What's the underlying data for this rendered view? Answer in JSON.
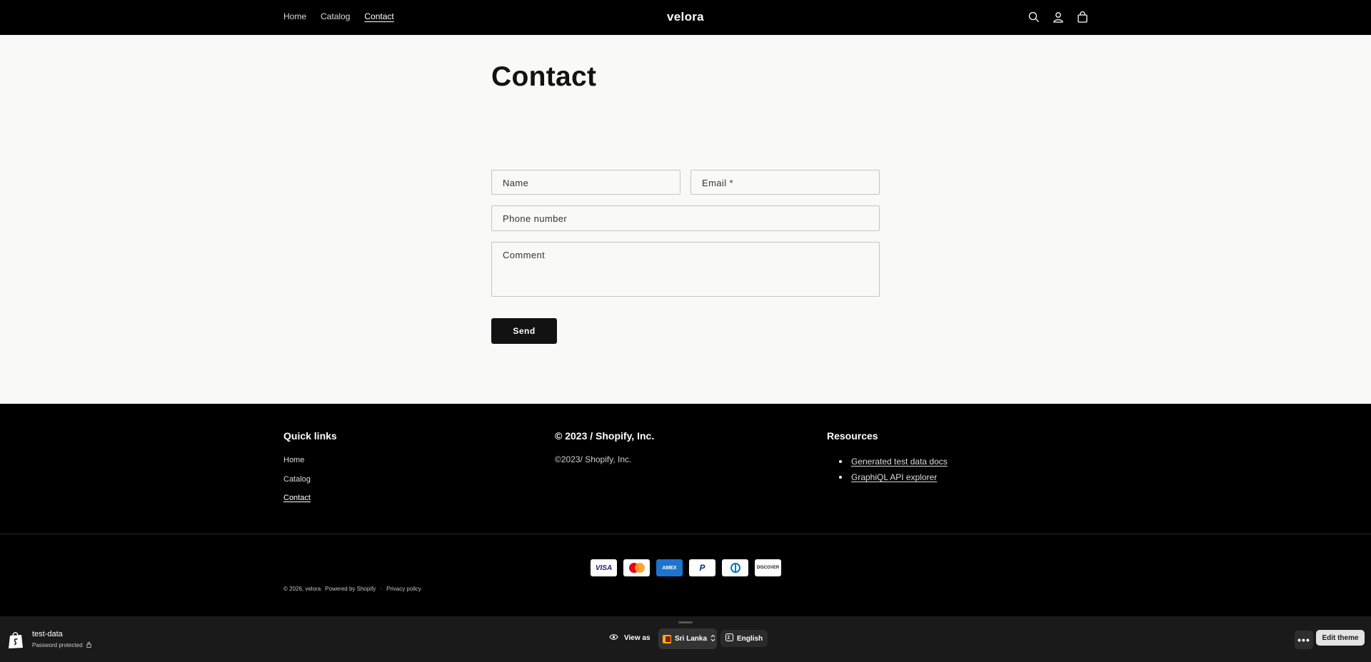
{
  "header": {
    "nav": [
      {
        "label": "Home"
      },
      {
        "label": "Catalog"
      },
      {
        "label": "Contact"
      }
    ],
    "logo": "velora",
    "icons": [
      "search-icon",
      "account-icon",
      "cart-icon"
    ]
  },
  "main": {
    "title": "Contact",
    "form": {
      "name_placeholder": "Name",
      "email_placeholder": "Email *",
      "phone_placeholder": "Phone number",
      "comment_placeholder": "Comment",
      "send_label": "Send"
    }
  },
  "footer": {
    "quick_links": {
      "title": "Quick links",
      "items": [
        {
          "label": "Home"
        },
        {
          "label": "Catalog"
        },
        {
          "label": "Contact"
        }
      ]
    },
    "copyright_col": {
      "title": "© 2023 / Shopify, Inc.",
      "body": "©2023/ Shopify, Inc."
    },
    "resources": {
      "title": "Resources",
      "items": [
        {
          "label": "Generated test data docs"
        },
        {
          "label": "GraphiQL API explorer"
        }
      ]
    },
    "payments": [
      {
        "name": "visa",
        "label": "VISA"
      },
      {
        "name": "mastercard",
        "label": ""
      },
      {
        "name": "amex",
        "label": "AMEX"
      },
      {
        "name": "paypal",
        "label": "P"
      },
      {
        "name": "diners",
        "label": ""
      },
      {
        "name": "discover",
        "label": "DISCOVER"
      }
    ],
    "legal": {
      "copyright": "© 2026, velora",
      "powered": "Powered by Shopify",
      "separator": "·",
      "privacy": "Privacy policy"
    }
  },
  "preview_bar": {
    "store_name": "test-data",
    "status": "Password protected",
    "view_as": "View as",
    "country": "Sri Lanka",
    "language": "English",
    "more": "•••",
    "edit_theme": "Edit theme"
  },
  "colors": {
    "header_bg": "#000000",
    "page_bg": "#f9f9f7",
    "button_bg": "#121212",
    "preview_bar_bg": "#1a1a1a"
  }
}
